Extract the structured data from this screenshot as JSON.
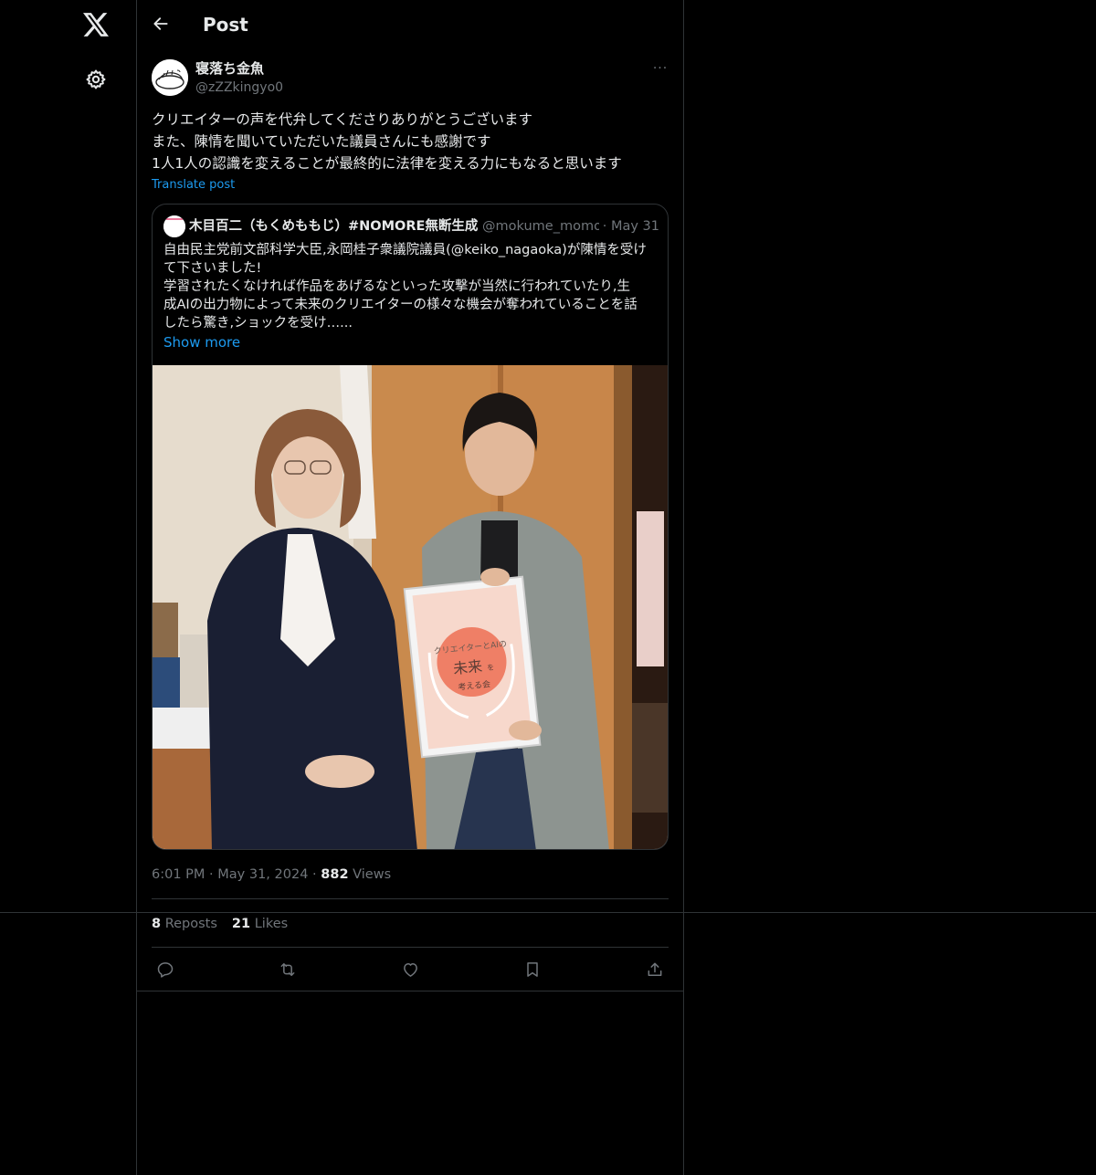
{
  "nav": {
    "logo_icon": "x-logo-icon",
    "settings_icon": "gear-icon"
  },
  "header": {
    "title": "Post",
    "back_icon": "arrow-left-icon"
  },
  "post": {
    "author_name": "寝落ち金魚",
    "author_handle": "@zZZkingyo0",
    "more_icon": "ellipsis-icon",
    "more_label": "···",
    "text_lines": [
      "クリエイターの声を代弁してくださりありがとうございます",
      "また、陳情を聞いていただいた議員さんにも感謝です",
      "1人1人の認識を変えることが最終的に法律を変える力にもなると思います"
    ],
    "translate_label": "Translate post",
    "time": "6:01 PM",
    "date": "May 31, 2024",
    "separator": "·",
    "views_count": "882",
    "views_label": "Views",
    "reposts_count": "8",
    "reposts_label": "Reposts",
    "likes_count": "21",
    "likes_label": "Likes"
  },
  "quote": {
    "author_name": "木目百二（もくめももじ）#NOMORE無断生成",
    "author_handle": "@mokume_momo",
    "separator": "·",
    "date": "May 31",
    "text_lines": [
      "自由民主党前文部科学大臣,永岡桂子衆議院議員(@keiko_nagaoka)が陳情を受け",
      "て下さいました!",
      "学習されたくなければ作品をあげるなといった攻撃が当然に行われていたり,生",
      "成AIの出力物によって未来のクリエイターの様々な機会が奪われていることを話",
      "したら驚き,ショックを受け…..."
    ],
    "show_more_label": "Show more",
    "photo": {
      "sign_line1": "クリエイターとAIの",
      "sign_line2": "未来",
      "sign_particle": "を",
      "sign_line3": "考える会"
    }
  },
  "actions": [
    {
      "icon": "reply-icon"
    },
    {
      "icon": "repost-icon"
    },
    {
      "icon": "like-heart-icon"
    },
    {
      "icon": "bookmark-icon"
    },
    {
      "icon": "share-icon"
    }
  ],
  "colors": {
    "background": "#000000",
    "text_primary": "#e7e9ea",
    "text_secondary": "#71767b",
    "accent": "#1d9bf0",
    "border": "#2f3336"
  }
}
